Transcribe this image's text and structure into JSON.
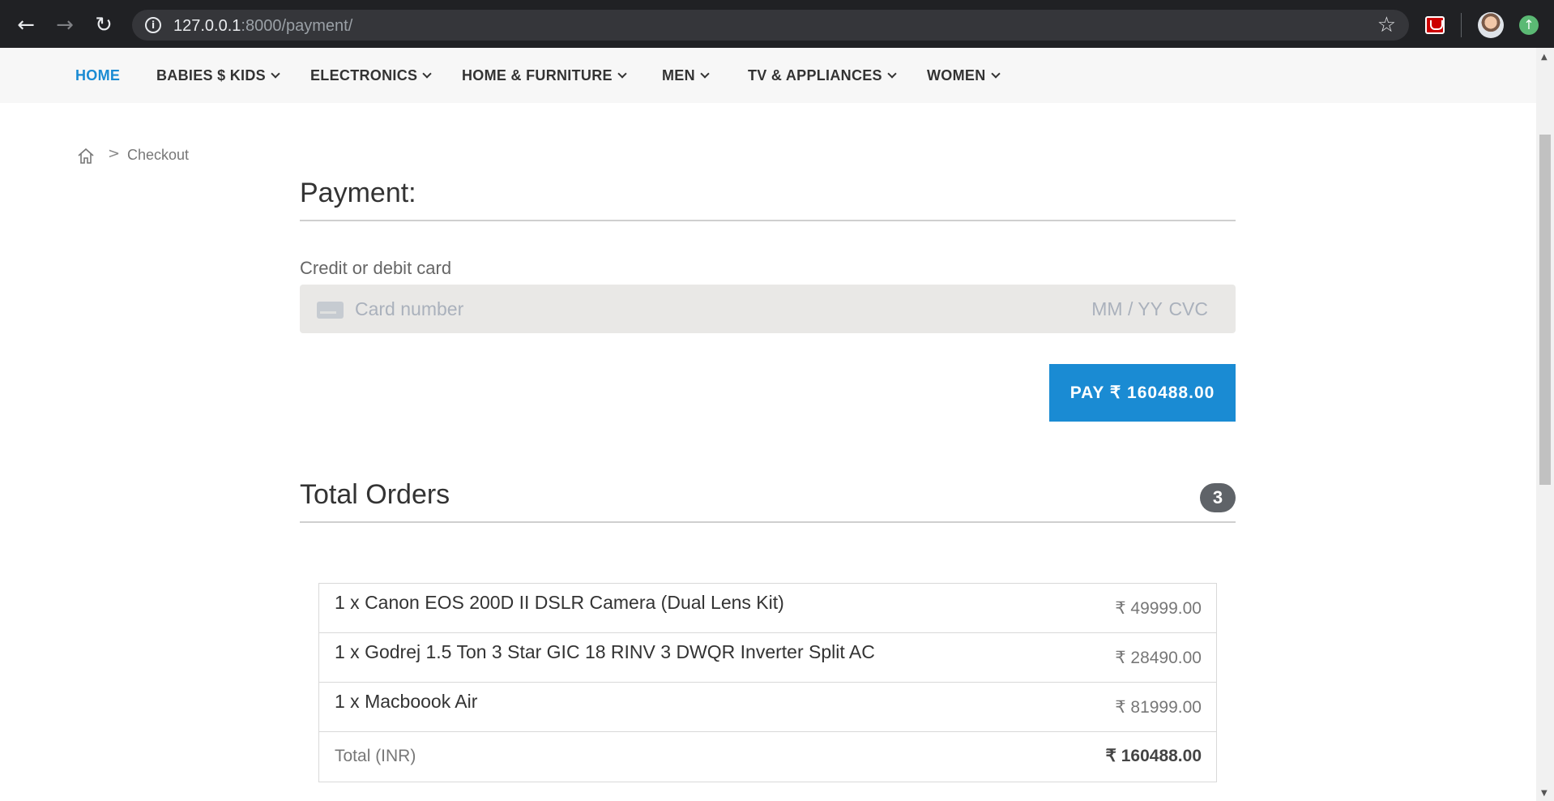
{
  "browser": {
    "url_host": "127.0.0.1",
    "url_rest": ":8000/payment/",
    "back_icon": "←",
    "forward_icon": "→",
    "reload_icon": "↻",
    "star_icon": "☆",
    "update_icon": "↑"
  },
  "menu": {
    "items": [
      {
        "label": "HOME",
        "active": true
      },
      {
        "label": "BABIES $ KIDS"
      },
      {
        "label": "ELECTRONICS"
      },
      {
        "label": "HOME & FURNITURE"
      },
      {
        "label": "MEN"
      },
      {
        "label": "TV & APPLIANCES"
      },
      {
        "label": "WOMEN"
      }
    ]
  },
  "breadcrumb": {
    "separator": ">",
    "current": "Checkout"
  },
  "payment": {
    "title": "Payment:",
    "card_label": "Credit or debit card",
    "card_placeholder": "Card number",
    "exp_placeholder": "MM / YY",
    "cvc_placeholder": "CVC",
    "pay_button": "PAY  ₹ 160488.00"
  },
  "orders": {
    "title": "Total Orders",
    "count": "3",
    "items": [
      {
        "name": "1 x Canon EOS 200D II DSLR Camera (Dual Lens Kit)",
        "price": "₹ 49999.00"
      },
      {
        "name": "1 x Godrej 1.5 Ton 3 Star GIC 18 RINV 3 DWQR Inverter Split AC",
        "price": "₹ 28490.00"
      },
      {
        "name": "1 x Macboook Air",
        "price": "₹ 81999.00"
      }
    ],
    "total_label": "Total (INR)",
    "total_value": "₹ 160488.00"
  },
  "colors": {
    "accent": "#1a8bd3",
    "chrome_bg": "#202124",
    "badge": "#5f6368"
  }
}
